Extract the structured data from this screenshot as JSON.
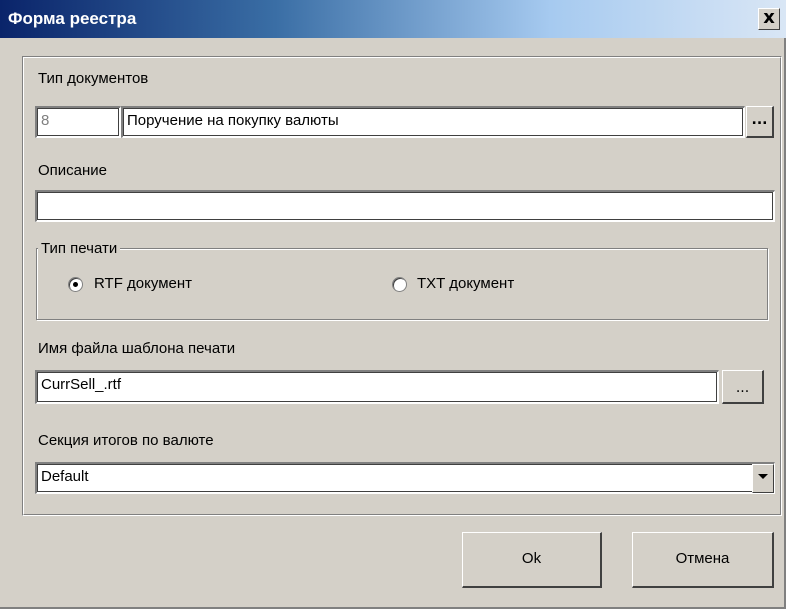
{
  "window": {
    "title": "Форма реестра",
    "close_label": "x"
  },
  "doc_type": {
    "label": "Тип документов",
    "code": "8",
    "name": "Поручение на покупку валюты",
    "browse_label": "..."
  },
  "description": {
    "label": "Описание",
    "value": ""
  },
  "print_type": {
    "legend": "Тип печати",
    "options": [
      {
        "label": "RTF документ",
        "selected": true
      },
      {
        "label": "TXT документ",
        "selected": false
      }
    ]
  },
  "template_file": {
    "label": "Имя файла шаблона печати",
    "value": "CurrSell_.rtf",
    "browse_label": "..."
  },
  "currency_section": {
    "label": "Секция итогов по валюте",
    "selected": "Default"
  },
  "buttons": {
    "ok": "Ok",
    "cancel": "Отмена"
  },
  "colors": {
    "face": "#d4d0c8",
    "title_start": "#0a246a",
    "title_end": "#a6caf0"
  }
}
